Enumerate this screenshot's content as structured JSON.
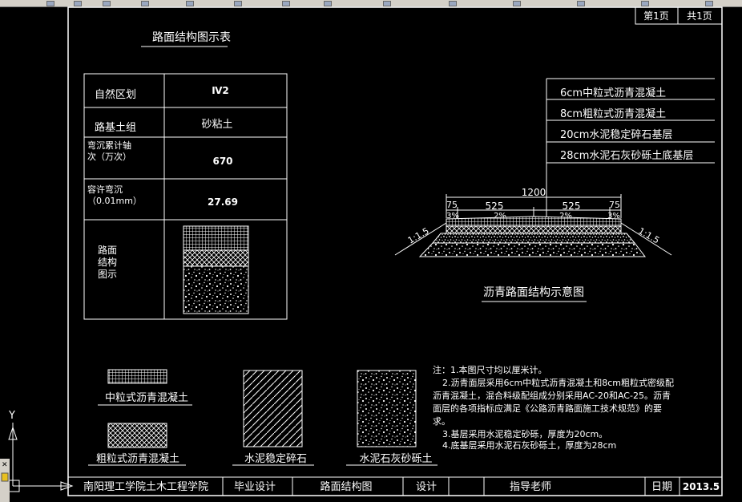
{
  "sheet": {
    "page_no": "第1页",
    "page_total": "共1页"
  },
  "table": {
    "title": "路面结构图示表",
    "rows": [
      {
        "label": "自然区划",
        "value": "Ⅳ2"
      },
      {
        "label": "路基土组",
        "value": "砂粘土"
      },
      {
        "label_lines": [
          "弯沉累计轴",
          "次（万次）"
        ],
        "value": "670"
      },
      {
        "label_lines": [
          "容许弯沉",
          "（0.01mm）"
        ],
        "value": "27.69"
      },
      {
        "label_lines": [
          "路面",
          "结构",
          "图示"
        ],
        "value": ""
      }
    ]
  },
  "layers": [
    "6cm中粒式沥青混凝土",
    "8cm粗粒式沥青混凝土",
    "20cm水泥稳定碎石基层",
    "28cm水泥石灰砂砾土底基层"
  ],
  "section": {
    "title": "沥青路面结构示意图",
    "dims": {
      "total": "1200",
      "shoulder": "75",
      "half": "525",
      "cross": "2%",
      "shoulder_slope": "3%",
      "side_slope": "1:1.5"
    }
  },
  "legend": [
    "中粒式沥青混凝土",
    "粗粒式沥青混凝土",
    "水泥稳定碎石",
    "水泥石灰砂砾土"
  ],
  "notes": [
    "注：1.本图尺寸均以厘米计。",
    "2.沥青面层采用6cm中粒式沥青混凝土和8cm粗粒式密级配",
    "沥青混凝土，混合料级配组成分别采用AC-20和AC-25。沥青",
    "面层的各项指标应满足《公路沥青路面施工技术规范》的要",
    "求。",
    "3.基层采用水泥稳定砂砾，厚度为20cm。",
    "4.底基层采用水泥石灰砂砾土，厚度为28cm"
  ],
  "title_block": {
    "school": "南阳理工学院土木工程学院",
    "type": "毕业设计",
    "drawing": "路面结构图",
    "design_label": "设计",
    "advisor_label": "指导老师",
    "date_label": "日期",
    "date": "2013.5"
  },
  "ucs": {
    "y_label": "Y"
  }
}
